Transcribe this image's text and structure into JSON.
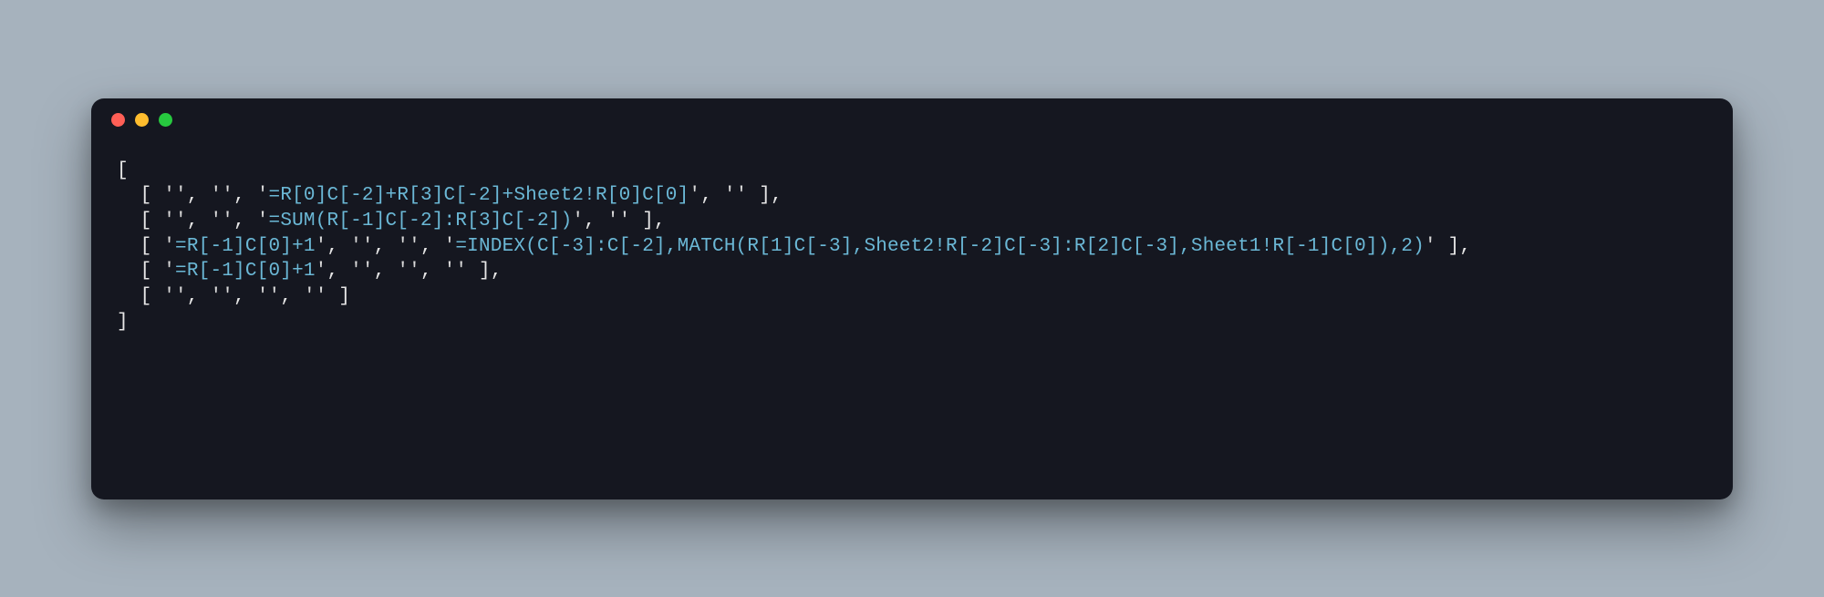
{
  "traffic_lights": {
    "red": "#ff5f56",
    "yellow": "#ffbd2e",
    "green": "#27c93f"
  },
  "code_lines": [
    {
      "indent": 0,
      "open": "[",
      "close": "",
      "cells": null,
      "trailing_comma": false
    },
    {
      "indent": 1,
      "open": "[",
      "close": "]",
      "cells": [
        "",
        "",
        "=R[0]C[-2]+R[3]C[-2]+Sheet2!R[0]C[0]",
        ""
      ],
      "trailing_comma": true
    },
    {
      "indent": 1,
      "open": "[",
      "close": "]",
      "cells": [
        "",
        "",
        "=SUM(R[-1]C[-2]:R[3]C[-2])",
        ""
      ],
      "trailing_comma": true
    },
    {
      "indent": 1,
      "open": "[",
      "close": "]",
      "cells": [
        "=R[-1]C[0]+1",
        "",
        "",
        "=INDEX(C[-3]:C[-2],MATCH(R[1]C[-3],Sheet2!R[-2]C[-3]:R[2]C[-3],Sheet1!R[-1]C[0]),2)"
      ],
      "trailing_comma": true
    },
    {
      "indent": 1,
      "open": "[",
      "close": "]",
      "cells": [
        "=R[-1]C[0]+1",
        "",
        "",
        ""
      ],
      "trailing_comma": true
    },
    {
      "indent": 1,
      "open": "[",
      "close": "]",
      "cells": [
        "",
        "",
        "",
        ""
      ],
      "trailing_comma": false
    },
    {
      "indent": 0,
      "open": "",
      "close": "]",
      "cells": null,
      "trailing_comma": false
    }
  ]
}
